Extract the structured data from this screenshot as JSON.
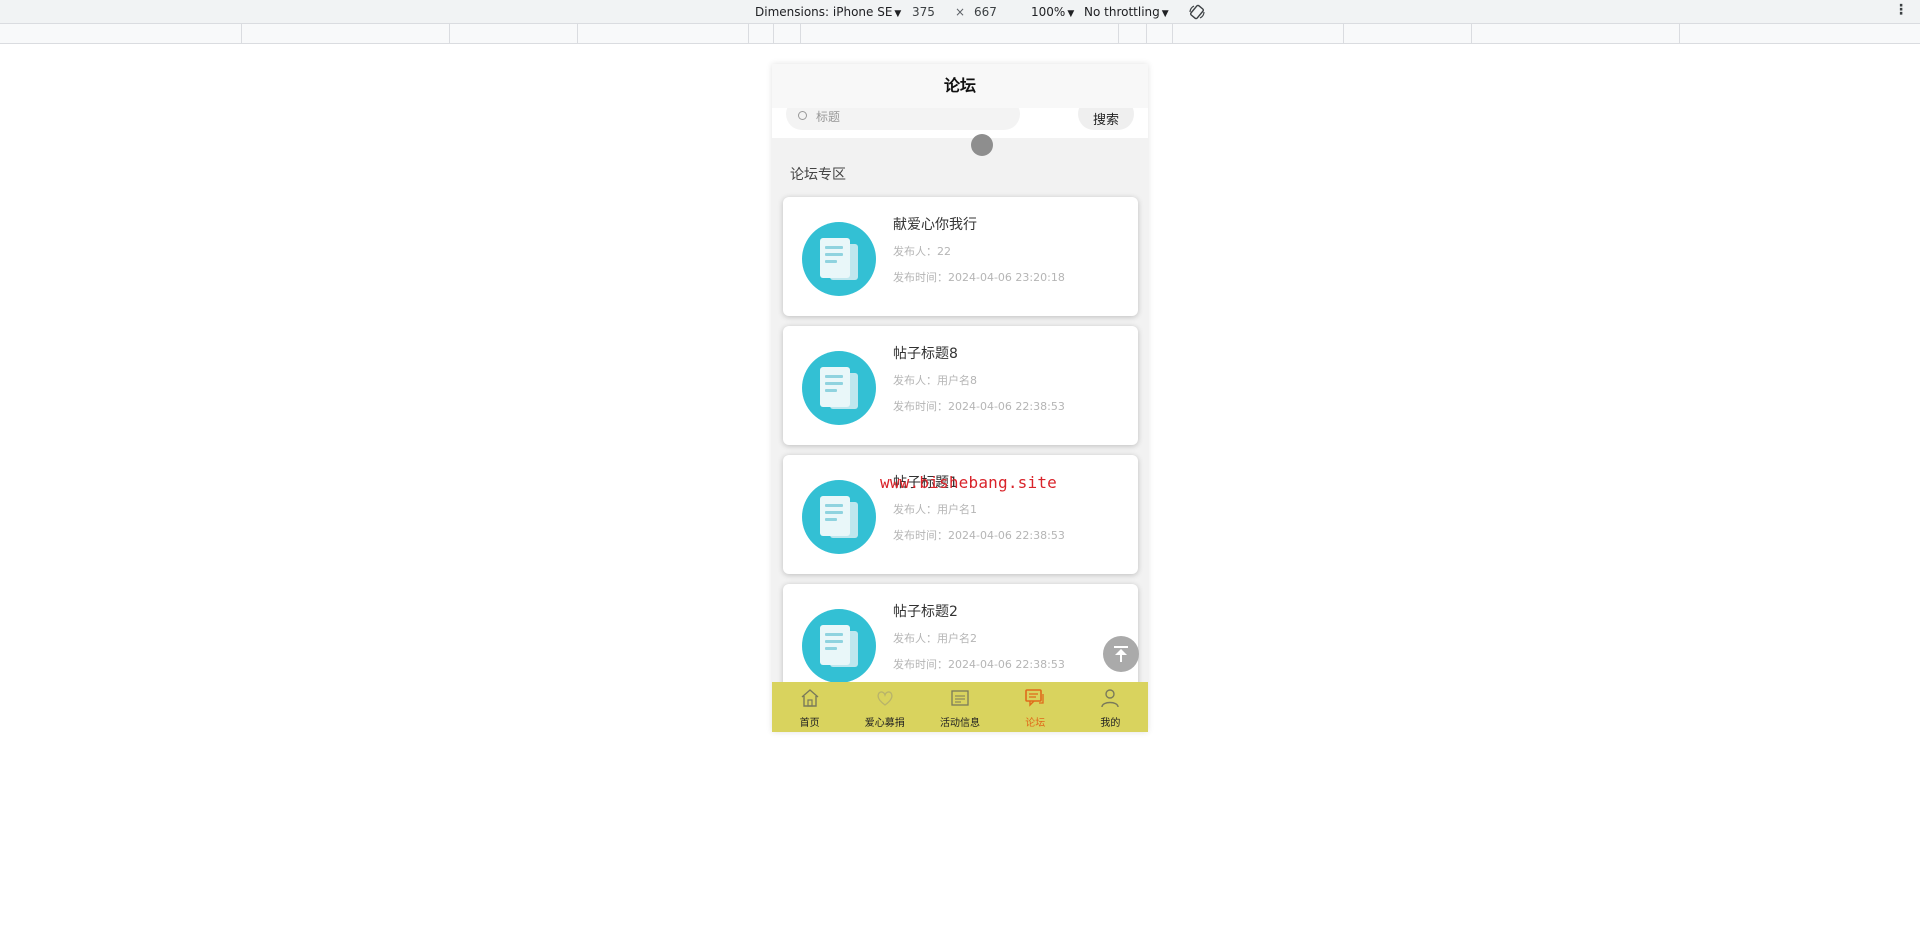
{
  "devtools": {
    "dimensions_label": "Dimensions: iPhone SE",
    "width": "375",
    "times": "×",
    "height": "667",
    "zoom": "100%",
    "throttling": "No throttling",
    "menu_glyph": "⋮"
  },
  "app": {
    "nav_title": "论坛",
    "search": {
      "placeholder": "标题",
      "button_label": "搜索"
    },
    "section_title": "论坛专区",
    "posts": [
      {
        "title": "献爱心你我行",
        "author": "发布人：22",
        "time": "发布时间：2024-04-06 23:20:18"
      },
      {
        "title": "帖子标题8",
        "author": "发布人：用户名8",
        "time": "发布时间：2024-04-06 22:38:53"
      },
      {
        "title": "帖子标题1",
        "author": "发布人：用户名1",
        "time": "发布时间：2024-04-06 22:38:53"
      },
      {
        "title": "帖子标题2",
        "author": "发布人：用户名2",
        "time": "发布时间：2024-04-06 22:38:53"
      }
    ],
    "tabs": [
      {
        "label": "首页",
        "icon": "home-icon",
        "active": false
      },
      {
        "label": "爱心募捐",
        "icon": "donate-icon",
        "active": false
      },
      {
        "label": "活动信息",
        "icon": "activity-icon",
        "active": false
      },
      {
        "label": "论坛",
        "icon": "forum-icon",
        "active": true
      },
      {
        "label": "我的",
        "icon": "user-icon",
        "active": false
      }
    ],
    "colors": {
      "tab_bar": "#d9d35e",
      "tab_active": "#e06a1a",
      "post_icon": "#33c0d4"
    }
  },
  "watermark": "www.bishebang.site"
}
